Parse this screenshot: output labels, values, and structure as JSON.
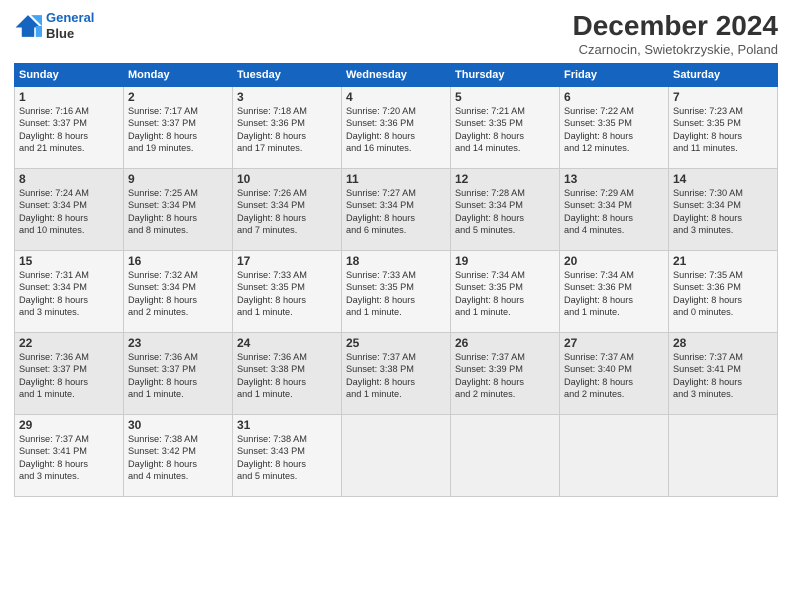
{
  "logo": {
    "line1": "General",
    "line2": "Blue"
  },
  "title": "December 2024",
  "subtitle": "Czarnocin, Swietokrzyskie, Poland",
  "headers": [
    "Sunday",
    "Monday",
    "Tuesday",
    "Wednesday",
    "Thursday",
    "Friday",
    "Saturday"
  ],
  "weeks": [
    [
      {
        "day": "1",
        "info": "Sunrise: 7:16 AM\nSunset: 3:37 PM\nDaylight: 8 hours\nand 21 minutes."
      },
      {
        "day": "2",
        "info": "Sunrise: 7:17 AM\nSunset: 3:37 PM\nDaylight: 8 hours\nand 19 minutes."
      },
      {
        "day": "3",
        "info": "Sunrise: 7:18 AM\nSunset: 3:36 PM\nDaylight: 8 hours\nand 17 minutes."
      },
      {
        "day": "4",
        "info": "Sunrise: 7:20 AM\nSunset: 3:36 PM\nDaylight: 8 hours\nand 16 minutes."
      },
      {
        "day": "5",
        "info": "Sunrise: 7:21 AM\nSunset: 3:35 PM\nDaylight: 8 hours\nand 14 minutes."
      },
      {
        "day": "6",
        "info": "Sunrise: 7:22 AM\nSunset: 3:35 PM\nDaylight: 8 hours\nand 12 minutes."
      },
      {
        "day": "7",
        "info": "Sunrise: 7:23 AM\nSunset: 3:35 PM\nDaylight: 8 hours\nand 11 minutes."
      }
    ],
    [
      {
        "day": "8",
        "info": "Sunrise: 7:24 AM\nSunset: 3:34 PM\nDaylight: 8 hours\nand 10 minutes."
      },
      {
        "day": "9",
        "info": "Sunrise: 7:25 AM\nSunset: 3:34 PM\nDaylight: 8 hours\nand 8 minutes."
      },
      {
        "day": "10",
        "info": "Sunrise: 7:26 AM\nSunset: 3:34 PM\nDaylight: 8 hours\nand 7 minutes."
      },
      {
        "day": "11",
        "info": "Sunrise: 7:27 AM\nSunset: 3:34 PM\nDaylight: 8 hours\nand 6 minutes."
      },
      {
        "day": "12",
        "info": "Sunrise: 7:28 AM\nSunset: 3:34 PM\nDaylight: 8 hours\nand 5 minutes."
      },
      {
        "day": "13",
        "info": "Sunrise: 7:29 AM\nSunset: 3:34 PM\nDaylight: 8 hours\nand 4 minutes."
      },
      {
        "day": "14",
        "info": "Sunrise: 7:30 AM\nSunset: 3:34 PM\nDaylight: 8 hours\nand 3 minutes."
      }
    ],
    [
      {
        "day": "15",
        "info": "Sunrise: 7:31 AM\nSunset: 3:34 PM\nDaylight: 8 hours\nand 3 minutes."
      },
      {
        "day": "16",
        "info": "Sunrise: 7:32 AM\nSunset: 3:34 PM\nDaylight: 8 hours\nand 2 minutes."
      },
      {
        "day": "17",
        "info": "Sunrise: 7:33 AM\nSunset: 3:35 PM\nDaylight: 8 hours\nand 1 minute."
      },
      {
        "day": "18",
        "info": "Sunrise: 7:33 AM\nSunset: 3:35 PM\nDaylight: 8 hours\nand 1 minute."
      },
      {
        "day": "19",
        "info": "Sunrise: 7:34 AM\nSunset: 3:35 PM\nDaylight: 8 hours\nand 1 minute."
      },
      {
        "day": "20",
        "info": "Sunrise: 7:34 AM\nSunset: 3:36 PM\nDaylight: 8 hours\nand 1 minute."
      },
      {
        "day": "21",
        "info": "Sunrise: 7:35 AM\nSunset: 3:36 PM\nDaylight: 8 hours\nand 0 minutes."
      }
    ],
    [
      {
        "day": "22",
        "info": "Sunrise: 7:36 AM\nSunset: 3:37 PM\nDaylight: 8 hours\nand 1 minute."
      },
      {
        "day": "23",
        "info": "Sunrise: 7:36 AM\nSunset: 3:37 PM\nDaylight: 8 hours\nand 1 minute."
      },
      {
        "day": "24",
        "info": "Sunrise: 7:36 AM\nSunset: 3:38 PM\nDaylight: 8 hours\nand 1 minute."
      },
      {
        "day": "25",
        "info": "Sunrise: 7:37 AM\nSunset: 3:38 PM\nDaylight: 8 hours\nand 1 minute."
      },
      {
        "day": "26",
        "info": "Sunrise: 7:37 AM\nSunset: 3:39 PM\nDaylight: 8 hours\nand 2 minutes."
      },
      {
        "day": "27",
        "info": "Sunrise: 7:37 AM\nSunset: 3:40 PM\nDaylight: 8 hours\nand 2 minutes."
      },
      {
        "day": "28",
        "info": "Sunrise: 7:37 AM\nSunset: 3:41 PM\nDaylight: 8 hours\nand 3 minutes."
      }
    ],
    [
      {
        "day": "29",
        "info": "Sunrise: 7:37 AM\nSunset: 3:41 PM\nDaylight: 8 hours\nand 3 minutes."
      },
      {
        "day": "30",
        "info": "Sunrise: 7:38 AM\nSunset: 3:42 PM\nDaylight: 8 hours\nand 4 minutes."
      },
      {
        "day": "31",
        "info": "Sunrise: 7:38 AM\nSunset: 3:43 PM\nDaylight: 8 hours\nand 5 minutes."
      },
      {
        "day": "",
        "info": ""
      },
      {
        "day": "",
        "info": ""
      },
      {
        "day": "",
        "info": ""
      },
      {
        "day": "",
        "info": ""
      }
    ]
  ]
}
